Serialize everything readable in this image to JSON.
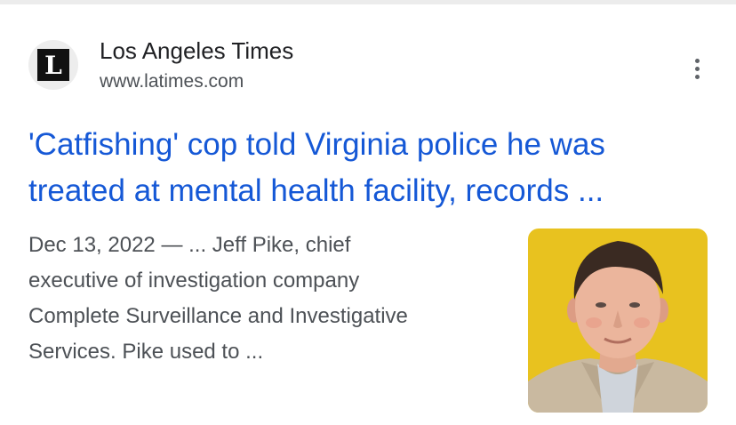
{
  "result": {
    "source": {
      "name": "Los Angeles Times",
      "url": "www.latimes.com",
      "logo_icon": "los-angeles-times-logo-icon",
      "logo_letter": "L"
    },
    "menu_icon": "more-vert-icon",
    "title_lines": [
      "'Catfishing' cop told Virginia police he was",
      "treated at mental health facility, records ..."
    ],
    "snippet_lines": [
      "Dec 13, 2022 — ... Jeff Pike, chief",
      "executive of investigation company",
      "Complete Surveillance and Investigative",
      "Services. Pike used to ..."
    ],
    "thumbnail_icon": "portrait-photo-thumbnail",
    "colors": {
      "title_link": "#1558d6",
      "snippet_text": "#4d5156",
      "source_name": "#202124",
      "thumbnail_background": "#e8c21f"
    }
  }
}
